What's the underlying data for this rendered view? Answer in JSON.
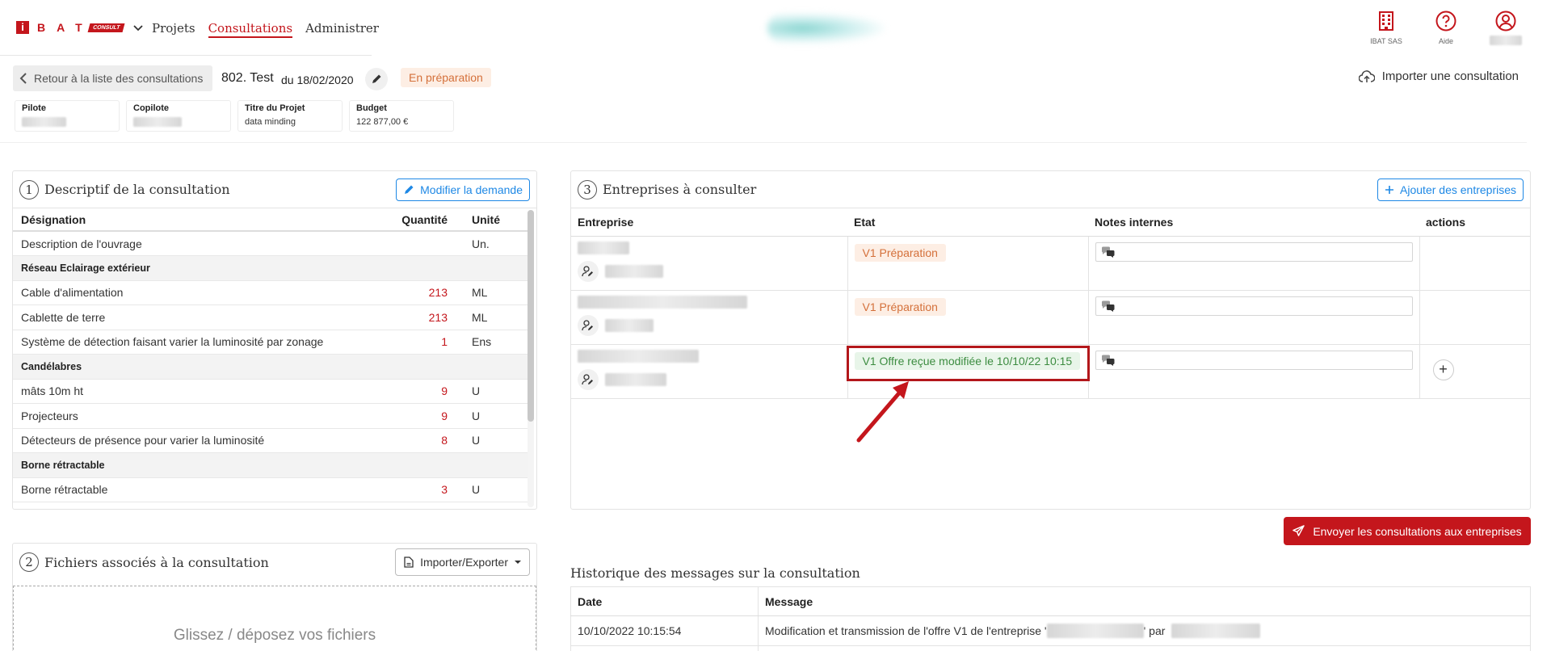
{
  "nav": {
    "logo_i": "i",
    "logo_letters": "BAT",
    "logo_badge": "CONSULT",
    "links": [
      {
        "label": "Projets",
        "active": false
      },
      {
        "label": "Consultations",
        "active": true
      },
      {
        "label": "Administrer",
        "active": false
      }
    ],
    "right_icons": [
      {
        "icon": "building-icon",
        "label": "IBAT SAS"
      },
      {
        "icon": "help-circle-icon",
        "label": "Aide"
      },
      {
        "icon": "user-circle-icon",
        "label": ""
      }
    ],
    "accent_color": "#c4161c"
  },
  "header": {
    "back_label": "Retour à la liste des consultations",
    "consult_title": "802. Test",
    "consult_date": "du 18/02/2020",
    "status": "En préparation",
    "import_label": "Importer une consultation"
  },
  "info_cards": [
    {
      "label": "Pilote",
      "value": ""
    },
    {
      "label": "Copilote",
      "value": ""
    },
    {
      "label": "Titre du Projet",
      "value": "data minding"
    },
    {
      "label": "Budget",
      "value": "122 877,00 €"
    }
  ],
  "panel1": {
    "num": "1",
    "title": "Descriptif de la consultation",
    "button": "Modifier la demande",
    "headers": {
      "designation": "Désignation",
      "quantite": "Quantité",
      "unite": "Unité"
    },
    "rows": [
      {
        "type": "item",
        "designation": "Description de l'ouvrage",
        "quantite": "",
        "unite": "Un."
      },
      {
        "type": "group",
        "designation": "Réseau Eclairage extérieur",
        "quantite": "",
        "unite": ""
      },
      {
        "type": "item",
        "designation": "Cable d'alimentation",
        "quantite": "213",
        "unite": "ML"
      },
      {
        "type": "item",
        "designation": "Cablette de terre",
        "quantite": "213",
        "unite": "ML"
      },
      {
        "type": "item",
        "designation": "Système de détection faisant varier la luminosité par zonage",
        "quantite": "1",
        "unite": "Ens"
      },
      {
        "type": "group",
        "designation": "Candélabres",
        "quantite": "",
        "unite": ""
      },
      {
        "type": "item",
        "designation": "mâts 10m ht",
        "quantite": "9",
        "unite": "U"
      },
      {
        "type": "item",
        "designation": "Projecteurs",
        "quantite": "9",
        "unite": "U"
      },
      {
        "type": "item",
        "designation": "Détecteurs de présence pour varier la luminosité",
        "quantite": "8",
        "unite": "U"
      },
      {
        "type": "group",
        "designation": "Borne rétractable",
        "quantite": "",
        "unite": ""
      },
      {
        "type": "item",
        "designation": "Borne rétractable",
        "quantite": "3",
        "unite": "U"
      }
    ]
  },
  "panel2": {
    "num": "2",
    "title": "Fichiers associés à la consultation",
    "button": "Importer/Exporter",
    "dropzone": "Glissez / déposez vos fichiers"
  },
  "panel3": {
    "num": "3",
    "title": "Entreprises à consulter",
    "button": "Ajouter des entreprises",
    "headers": {
      "entreprise": "Entreprise",
      "etat": "Etat",
      "notes": "Notes internes",
      "actions": "actions"
    },
    "rows": [
      {
        "etat": "V1 Préparation",
        "etat_kind": "prep",
        "has_action": false
      },
      {
        "etat": "V1 Préparation",
        "etat_kind": "prep",
        "has_action": false
      },
      {
        "etat": "V1 Offre reçue modifiée le 10/10/22 10:15",
        "etat_kind": "recu",
        "has_action": true
      }
    ],
    "add_action": "+"
  },
  "send_button": "Envoyer les consultations aux entreprises",
  "history": {
    "title": "Historique des messages sur la consultation",
    "headers": {
      "date": "Date",
      "message": "Message"
    },
    "rows": [
      {
        "date": "10/10/2022 10:15:54",
        "msg_prefix": "Modification et transmission de l'offre V1 de l'entreprise '",
        "msg_mid": "' par"
      }
    ]
  }
}
